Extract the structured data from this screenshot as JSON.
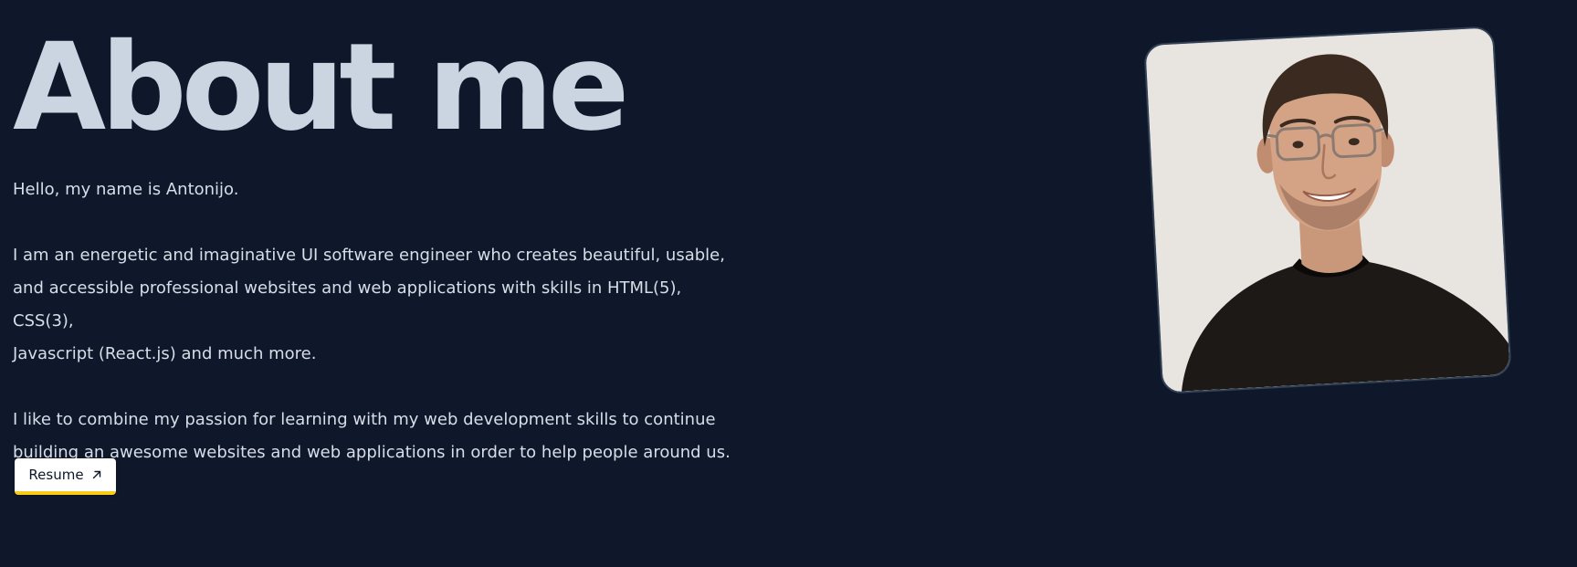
{
  "about": {
    "title": "About me",
    "greeting": "Hello, my name is Antonijo.",
    "bio_lines_1": [
      "I am an energetic and imaginative UI software engineer who creates beautiful, usable,",
      "and accessible professional websites and web applications with skills in HTML(5), CSS(3),",
      "Javascript (React.js) and much more."
    ],
    "bio_lines_2": [
      "I like to combine my passion for learning with my web development skills to continue",
      "building an awesome websites and web applications in order to help people around us."
    ],
    "resume_button": {
      "label": "Resume",
      "icon": "arrow-up-right-icon"
    },
    "photo": {
      "description_icon": "profile-photo"
    }
  },
  "colors": {
    "background": "#0f172a",
    "text": "#cbd5e1",
    "accent": "#facc15",
    "button_bg": "#ffffff"
  }
}
